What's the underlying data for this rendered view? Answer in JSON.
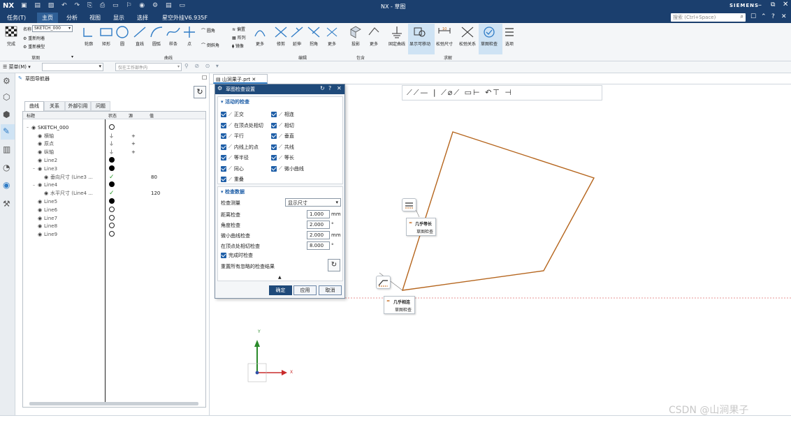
{
  "app": {
    "logo": "NX",
    "title": "NX - 草图",
    "brand": "SIEMENS",
    "search_placeholder": "搜索 (Ctrl+Space)",
    "brand_color": "#1b3f6e"
  },
  "menu": {
    "items": [
      "任务(T)",
      "主页",
      "分析",
      "视图",
      "显示",
      "选择",
      "星空外挂V6.935F"
    ],
    "active": "主页"
  },
  "ribbon": {
    "finish": "完成",
    "name_label": "名称",
    "name_value": "SKETCH_000",
    "sketch_options": [
      "重新附着",
      "重新模型"
    ],
    "curve_tools": [
      "轮廓",
      "矩形",
      "圆",
      "直线",
      "圆弧",
      "样条",
      "点",
      "圆角",
      "倒斜角"
    ],
    "curve_side": [
      "偏置",
      "阵列",
      "镜像",
      "更多"
    ],
    "edit_tools": [
      "修剪",
      "延伸",
      "拐角",
      "更多"
    ],
    "incl_tools": [
      "投影",
      "更多"
    ],
    "constraint_tools": [
      "固定曲线",
      "显示可移动",
      "松弛尺寸",
      "松弛关系",
      "草图检查",
      "选项"
    ],
    "groups": {
      "sketch": "草图",
      "curve": "曲线",
      "edit": "编辑",
      "include": "包含",
      "constraint": "求解"
    }
  },
  "selbar": {
    "menu_label": "菜单(M)",
    "filter_placeholder": "",
    "scope": "仅在工作部件内"
  },
  "nav": {
    "title": "草图导航器",
    "tabs": [
      "曲线",
      "关系",
      "外部引用",
      "问题"
    ],
    "active_tab": "曲线",
    "columns": {
      "name": "标题",
      "status": "状态",
      "ref": "源",
      "value": "值"
    },
    "rows": [
      {
        "name": "SKETCH_000",
        "status": "open",
        "ref": "",
        "value": ""
      },
      {
        "name": "横轴",
        "status": "ground",
        "ref": "+",
        "value": ""
      },
      {
        "name": "原点",
        "status": "ground",
        "ref": "+",
        "value": ""
      },
      {
        "name": "纵轴",
        "status": "ground",
        "ref": "+",
        "value": ""
      },
      {
        "name": "Line2",
        "status": "filled",
        "ref": "",
        "value": ""
      },
      {
        "name": "Line3",
        "status": "filled",
        "ref": "",
        "value": ""
      },
      {
        "name": "垂向尺寸 (Line3 ...",
        "status": "check",
        "ref": "",
        "value": "80"
      },
      {
        "name": "Line4",
        "status": "filled",
        "ref": "",
        "value": ""
      },
      {
        "name": "水平尺寸 (Line4 ...",
        "status": "check",
        "ref": "",
        "value": "120"
      },
      {
        "name": "Line5",
        "status": "filled",
        "ref": "",
        "value": ""
      },
      {
        "name": "Line6",
        "status": "open",
        "ref": "",
        "value": ""
      },
      {
        "name": "Line7",
        "status": "open",
        "ref": "",
        "value": ""
      },
      {
        "name": "Line8",
        "status": "open",
        "ref": "",
        "value": ""
      },
      {
        "name": "Line9",
        "status": "open",
        "ref": "",
        "value": ""
      }
    ]
  },
  "tab": {
    "label": "山涧果子.prt"
  },
  "dialog": {
    "title": "草图检查设置",
    "sec1": "活动的检查",
    "checks_left": [
      "正交",
      "在顶点处相切",
      "平行",
      "内线上的点",
      "等半径",
      "同心",
      "重叠"
    ],
    "checks_right": [
      "相连",
      "相切",
      "垂直",
      "共线",
      "等长",
      "微小曲线"
    ],
    "sec2": "检查数据",
    "measure_label": "检查测量",
    "measure_value": "显示尺寸",
    "fields": [
      {
        "label": "距离检查",
        "value": "1.000",
        "unit": "mm"
      },
      {
        "label": "角度检查",
        "value": "2.000",
        "unit": "°"
      },
      {
        "label": "微小曲线检查",
        "value": "2.000",
        "unit": "mm"
      },
      {
        "label": "在顶点处相切检查",
        "value": "8.000",
        "unit": "°"
      }
    ],
    "complete_check": "完成时检查",
    "reset_label": "重置所有忽略的检查结果",
    "ok": "确定",
    "apply": "应用",
    "cancel": "取消"
  },
  "notes": [
    {
      "title": "几乎等长",
      "sub": "草图检查"
    },
    {
      "title": "几乎相连",
      "sub": "草图检查"
    }
  ],
  "axes": {
    "x": "X",
    "y": "Y"
  },
  "watermark": "CSDN @山涧果子"
}
